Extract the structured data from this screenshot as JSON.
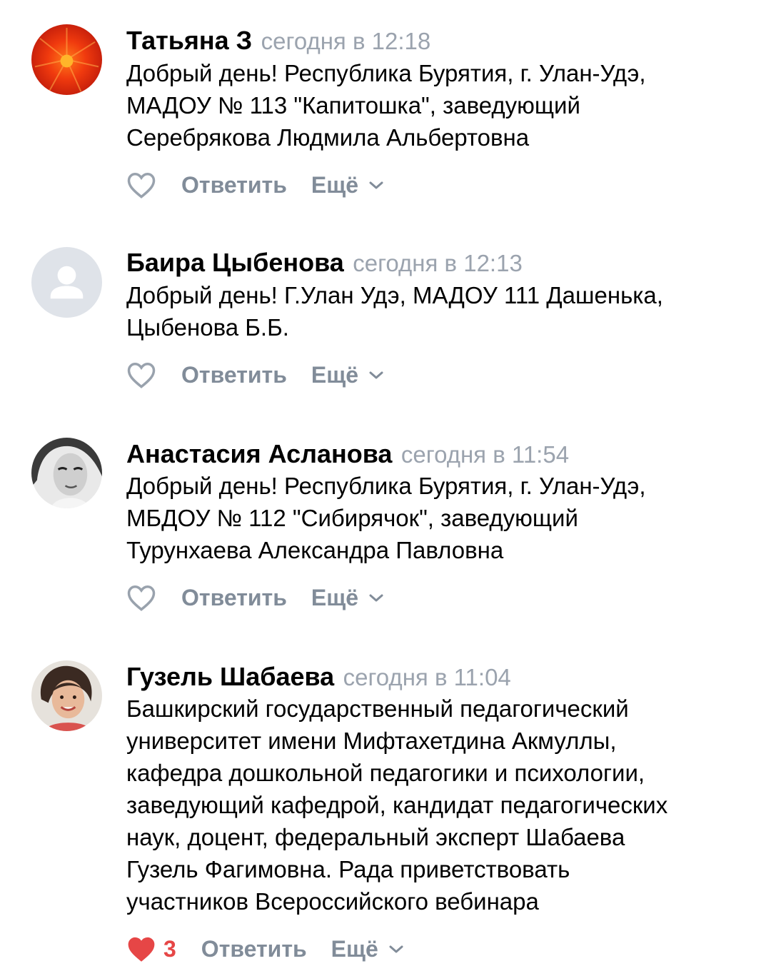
{
  "comments": [
    {
      "author": "Татьяна З",
      "time": "сегодня в 12:18",
      "text": "Добрый день! Республика Бурятия, г. Улан-Удэ,\nМАДОУ № 113 \"Капитошка\", заведующий\nСеребрякова Людмила Альбертовна",
      "liked": false,
      "like_count": "",
      "reply_label": "Ответить",
      "more_label": "Ещё"
    },
    {
      "author": "Баира Цыбенова",
      "time": "сегодня в 12:13",
      "text": "Добрый день! Г.Улан Удэ, МАДОУ 111 Дашенька,\nЦыбенова Б.Б.",
      "liked": false,
      "like_count": "",
      "reply_label": "Ответить",
      "more_label": "Ещё"
    },
    {
      "author": "Анастасия Асланова",
      "time": "сегодня в 11:54",
      "text": "Добрый день! Республика Бурятия, г. Улан-Удэ,\nМБДОУ № 112 \"Сибирячок\", заведующий\nТурунхаева Александра Павловна",
      "liked": false,
      "like_count": "",
      "reply_label": "Ответить",
      "more_label": "Ещё"
    },
    {
      "author": "Гузель Шабаева",
      "time": "сегодня в 11:04",
      "text": "Башкирский государственный педагогический\nуниверситет имени Мифтахетдина Акмуллы,\nкафедра дошкольной педагогики и психологии,\nзаведующий кафедрой, кандидат педагогических\nнаук, доцент, федеральный эксперт Шабаева\nГузель Фагимовна. Рада приветствовать\nучастников Всероссийского вебинара",
      "liked": true,
      "like_count": "3",
      "reply_label": "Ответить",
      "more_label": "Ещё"
    }
  ],
  "colors": {
    "name": "#000000",
    "time": "#9ba3ae",
    "action": "#818c99",
    "like_active": "#e64646",
    "like_inactive": "#99a2ad"
  }
}
